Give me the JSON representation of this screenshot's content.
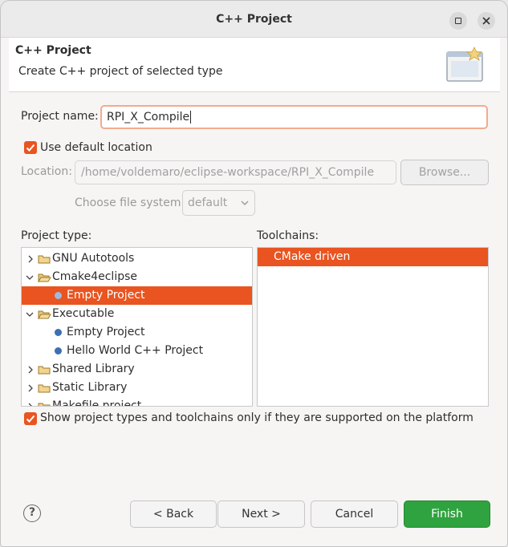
{
  "window": {
    "title": "C++ Project"
  },
  "banner": {
    "title": "C++ Project",
    "message": "Create C++ project of selected type"
  },
  "project_name": {
    "label": "Project name:",
    "value": "RPI_X_Compile"
  },
  "use_default_location": {
    "label": "Use default location",
    "checked": true
  },
  "location": {
    "label": "Location:",
    "value": "/home/voldemaro/eclipse-workspace/RPI_X_Compile",
    "browse_label": "Browse..."
  },
  "file_system": {
    "label": "Choose file system:",
    "selected": "default"
  },
  "project_type": {
    "label": "Project type:",
    "items": [
      {
        "label": "GNU Autotools",
        "kind": "folder",
        "expanded": false
      },
      {
        "label": "Cmake4eclipse",
        "kind": "folder",
        "expanded": true
      },
      {
        "label": "Empty Project",
        "kind": "leaf",
        "selected": true
      },
      {
        "label": "Executable",
        "kind": "folder",
        "expanded": true
      },
      {
        "label": "Empty Project",
        "kind": "leaf"
      },
      {
        "label": "Hello World C++ Project",
        "kind": "leaf"
      },
      {
        "label": "Shared Library",
        "kind": "folder",
        "expanded": false
      },
      {
        "label": "Static Library",
        "kind": "folder",
        "expanded": false
      },
      {
        "label": "Makefile project",
        "kind": "folder",
        "expanded": false
      }
    ]
  },
  "toolchains": {
    "label": "Toolchains:",
    "items": [
      {
        "label": "CMake driven",
        "selected": true
      }
    ]
  },
  "show_supported": {
    "label": "Show project types and toolchains only if they are supported on the platform",
    "checked": true
  },
  "buttons": {
    "back": "< Back",
    "next": "Next >",
    "cancel": "Cancel",
    "finish": "Finish"
  },
  "icons": {
    "help": "help-icon",
    "folder": "folder-icon",
    "project": "project-bullet-icon",
    "wizard": "new-project-wizard-icon"
  },
  "colors": {
    "accent": "#e95420",
    "finish": "#2fa33f",
    "tree_bullet": "#3c6fb4"
  }
}
